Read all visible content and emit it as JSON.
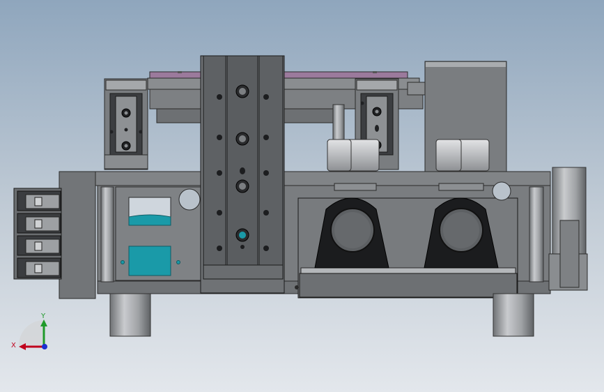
{
  "viewport": {
    "view": "front",
    "background_top": "#8fa6bd",
    "background_bottom": "#e3e7ec"
  },
  "model": {
    "part_color": "#7a7d80",
    "dark_part_color": "#3c3e41",
    "cylinder_color": "#b8babd",
    "plate_highlight_color": "#9b7a9c",
    "accent_cyan": "#1a9aa8",
    "bearing_block_color": "#1b1c1e"
  },
  "triad": {
    "x_label": "X",
    "y_label": "Y",
    "x_color": "#c0001c",
    "y_color": "#1f9a2a",
    "z_color": "#1c2fd0"
  }
}
